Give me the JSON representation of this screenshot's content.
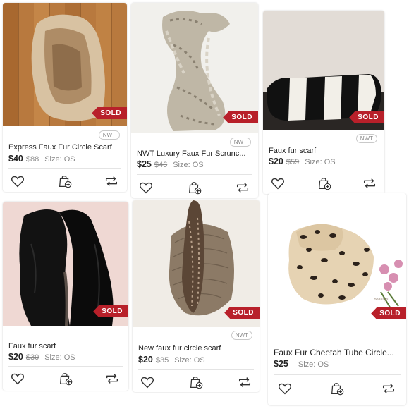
{
  "listings": [
    {
      "title": "Express Faux Fur Circle Scarf",
      "price": "$40",
      "original_price": "$88",
      "size": "Size: OS",
      "badge": "NWT",
      "status": "SOLD"
    },
    {
      "title": "NWT Luxury Faux Fur Scrunc...",
      "price": "$25",
      "original_price": "$46",
      "size": "Size: OS",
      "badge": "NWT",
      "status": "SOLD"
    },
    {
      "title": "Faux fur scarf",
      "price": "$20",
      "original_price": "$59",
      "size": "Size: OS",
      "badge": "NWT",
      "status": "SOLD"
    },
    {
      "title": "Faux fur scarf",
      "price": "$20",
      "original_price": "$30",
      "size": "Size: OS",
      "status": "SOLD"
    },
    {
      "title": "New faux fur circle scarf",
      "price": "$20",
      "original_price": "$35",
      "size": "Size: OS",
      "badge": "NWT",
      "status": "SOLD"
    },
    {
      "title": "Faux Fur Cheetah Tube Circle...",
      "price": "$25",
      "size": "Size: OS",
      "status": "SOLD"
    }
  ],
  "photo_watermark": "Beautiful",
  "icons": {
    "like": "heart-icon",
    "bundle": "shopping-bag-plus-icon",
    "share": "share-arrows-icon"
  },
  "colors": {
    "sold_badge": "#b8202a",
    "text": "#222222",
    "muted": "#888888"
  }
}
